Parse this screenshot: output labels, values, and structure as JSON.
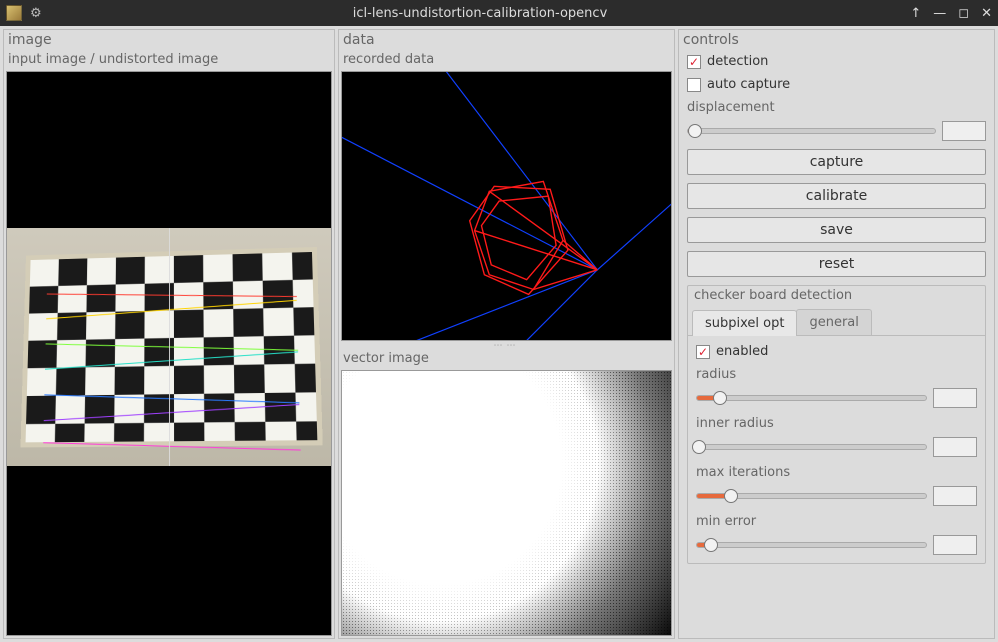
{
  "window": {
    "title": "icl-lens-undistortion-calibration-opencv"
  },
  "panels": {
    "image": {
      "title": "image",
      "input_label": "input image / undistorted image"
    },
    "data": {
      "title": "data",
      "recorded_label": "recorded data",
      "vector_label": "vector image"
    },
    "controls": {
      "title": "controls",
      "detection_label": "detection",
      "detection_checked": true,
      "autocapture_label": "auto capture",
      "autocapture_checked": false,
      "displacement_label": "displacement",
      "displacement_pct": 3,
      "displacement_value": "",
      "buttons": {
        "capture": "capture",
        "calibrate": "calibrate",
        "save": "save",
        "reset": "reset"
      },
      "detection_panel": {
        "title": "checker board detection",
        "tabs": {
          "subpixel": "subpixel opt",
          "general": "general"
        },
        "active_tab": "subpixel",
        "enabled_label": "enabled",
        "enabled_checked": true,
        "sliders": {
          "radius": {
            "label": "radius",
            "pct": 10,
            "value": ""
          },
          "inner_radius": {
            "label": "inner radius",
            "pct": 1,
            "value": ""
          },
          "max_iter": {
            "label": "max iterations",
            "pct": 15,
            "value": ""
          },
          "min_error": {
            "label": "min error",
            "pct": 6,
            "value": ""
          }
        }
      }
    }
  }
}
